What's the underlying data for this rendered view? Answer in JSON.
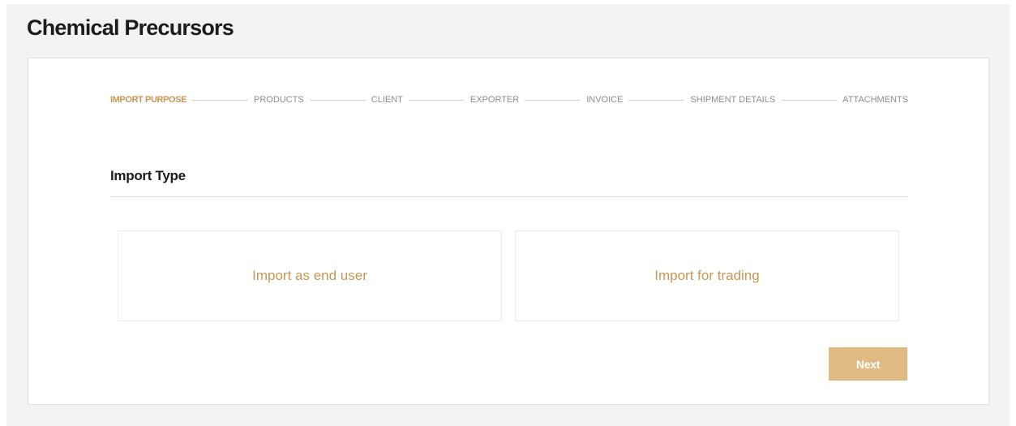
{
  "header": {
    "title": "Chemical Precursors"
  },
  "stepper": {
    "steps": [
      {
        "label": "IMPORT PURPOSE",
        "active": true
      },
      {
        "label": "PRODUCTS",
        "active": false
      },
      {
        "label": "CLIENT",
        "active": false
      },
      {
        "label": "EXPORTER",
        "active": false
      },
      {
        "label": "INVOICE",
        "active": false
      },
      {
        "label": "SHIPMENT DETAILS",
        "active": false
      },
      {
        "label": "ATTACHMENTS",
        "active": false
      }
    ]
  },
  "section": {
    "title": "Import Type"
  },
  "options": [
    {
      "label": "Import as end user"
    },
    {
      "label": "Import for trading"
    }
  ],
  "actions": {
    "next_label": "Next"
  },
  "colors": {
    "accent": "#c99653",
    "button_bg": "#dfbb83",
    "page_bg": "#f4f3f2",
    "inactive_step": "#8e8e8e",
    "title_text": "#1c1c1c"
  }
}
